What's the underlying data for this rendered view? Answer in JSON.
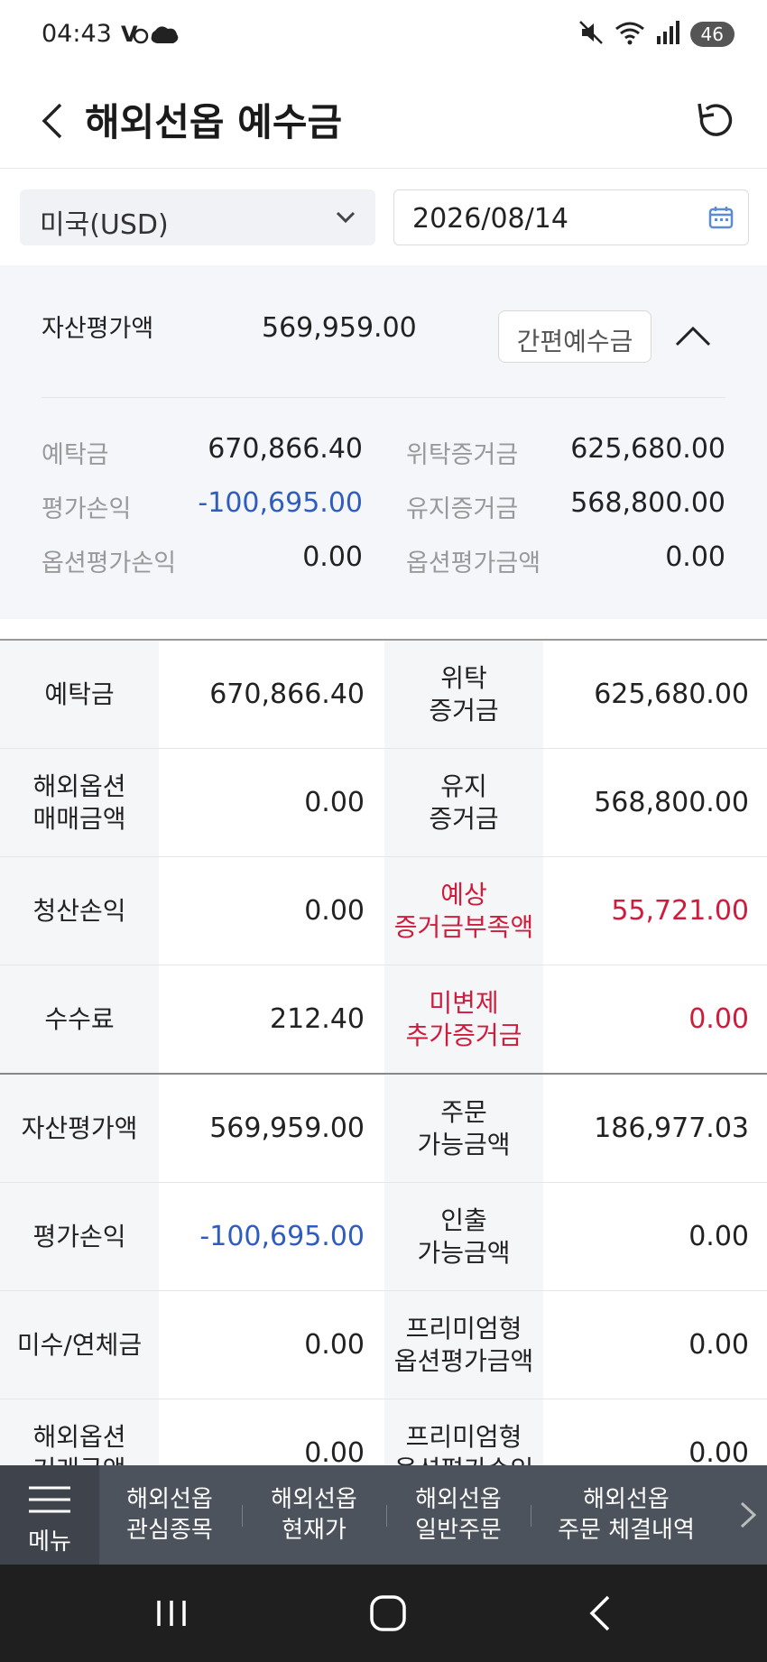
{
  "status": {
    "time": "04:43",
    "battery": "46"
  },
  "header": {
    "title": "해외선옵 예수금"
  },
  "filters": {
    "currency": "미국(USD)",
    "date": "2026/08/14"
  },
  "summary": {
    "asset_label": "자산평가액",
    "asset_value": "569,959.00",
    "simple_button": "간편예수금",
    "rows": [
      {
        "k1": "예탁금",
        "v1": "670,866.40",
        "k2": "위탁증거금",
        "v2": "625,680.00"
      },
      {
        "k1": "평가손익",
        "v1": "-100,695.00",
        "k2": "유지증거금",
        "v2": "568,800.00"
      },
      {
        "k1": "옵션평가손익",
        "v1": "0.00",
        "k2": "옵션평가금액",
        "v2": "0.00"
      }
    ]
  },
  "table": {
    "rows": [
      {
        "k1": "예탁금",
        "v1": "670,866.40",
        "k2": "위탁\n증거금",
        "v2": "625,680.00"
      },
      {
        "k1": "해외옵션\n매매금액",
        "v1": "0.00",
        "k2": "유지\n증거금",
        "v2": "568,800.00"
      },
      {
        "k1": "청산손익",
        "v1": "0.00",
        "k2": "예상\n증거금부족액",
        "v2": "55,721.00"
      },
      {
        "k1": "수수료",
        "v1": "212.40",
        "k2": "미변제\n추가증거금",
        "v2": "0.00"
      },
      {
        "k1": "자산평가액",
        "v1": "569,959.00",
        "k2": "주문\n가능금액",
        "v2": "186,977.03"
      },
      {
        "k1": "평가손익",
        "v1": "-100,695.00",
        "k2": "인출\n가능금액",
        "v2": "0.00"
      },
      {
        "k1": "미수/연체금",
        "v1": "0.00",
        "k2": "프리미엄형\n옵션평가금액",
        "v2": "0.00"
      },
      {
        "k1": "해외옵션\n거래금액",
        "v1": "0.00",
        "k2": "프리미엄형\n옵션평가손익",
        "v2": "0.00"
      }
    ]
  },
  "bottom_menu": {
    "menu_label": "메뉴",
    "items": [
      "해외선옵\n관심종목",
      "해외선옵\n현재가",
      "해외선옵\n일반주문",
      "해외선옵\n주문 체결내역"
    ]
  },
  "colors": {
    "negative": "#2f5dbf",
    "warning": "#d01c3c",
    "accent": "#5b8bd6"
  }
}
